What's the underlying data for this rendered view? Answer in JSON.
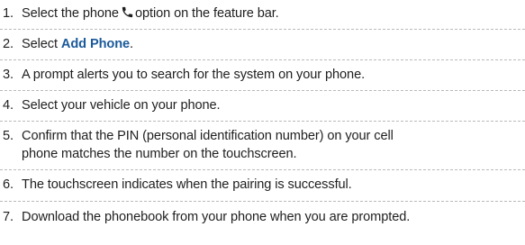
{
  "steps": [
    {
      "number": "1.",
      "before": "Select the phone",
      "icon": "phone-icon",
      "after": "option on the feature bar."
    },
    {
      "number": "2.",
      "before": "Select ",
      "bold": "Add Phone",
      "after": "."
    },
    {
      "number": "3.",
      "text": "A prompt alerts you to search for the system on your phone."
    },
    {
      "number": "4.",
      "text": "Select your vehicle on your phone."
    },
    {
      "number": "5.",
      "line1": "Confirm that the PIN (personal identification number) on your cell",
      "line2": "phone matches the number on the touchscreen."
    },
    {
      "number": "6.",
      "text": "The touchscreen indicates when the pairing is successful."
    },
    {
      "number": "7.",
      "text": "Download the phonebook from your phone when you are prompted."
    }
  ],
  "colors": {
    "text": "#1f1f1f",
    "emphasis": "#1b5a9b",
    "divider": "#b9b9b9"
  }
}
